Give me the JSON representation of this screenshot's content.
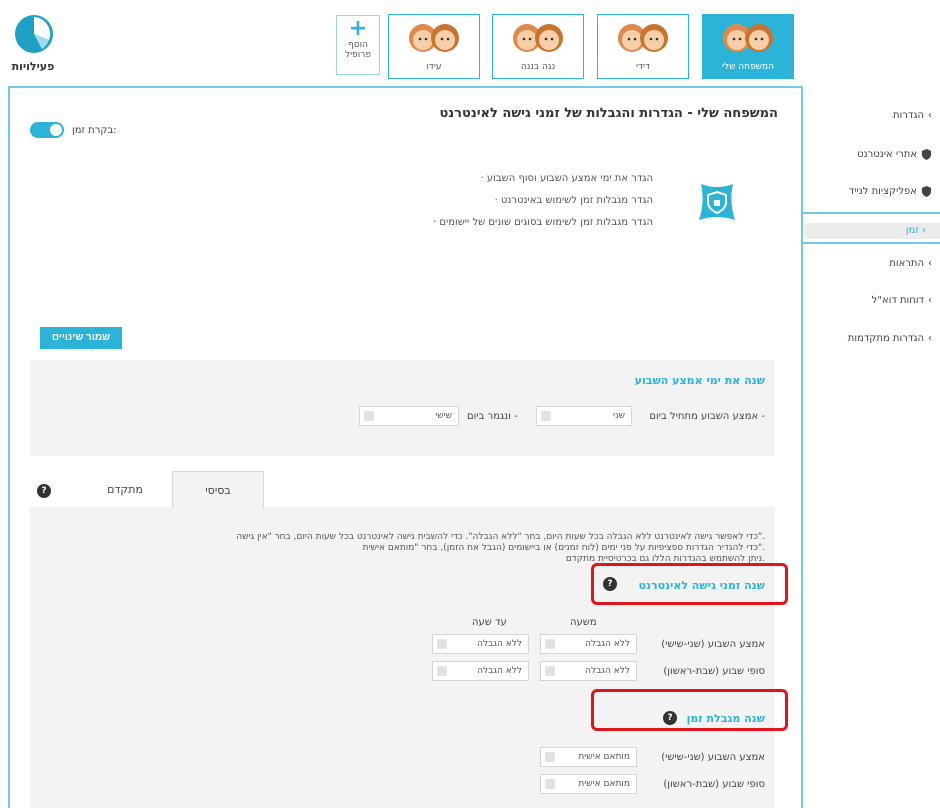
{
  "header": {
    "activity_label": "פעילויות",
    "add_profile_label_1": "הוסף",
    "add_profile_label_2": "פרופיל",
    "add_profile_symbol": "+",
    "profiles": [
      {
        "name": "המשפחה שלי",
        "active": true
      },
      {
        "name": "דידי",
        "active": false
      },
      {
        "name": "נגה בננה",
        "active": false
      },
      {
        "name": "עידו",
        "active": false
      }
    ]
  },
  "sidebar": {
    "items": [
      {
        "label": "הגדרות",
        "icon": "chevron-left-icon"
      },
      {
        "label": "אתרי אינטרנט",
        "icon": "shield-icon"
      },
      {
        "label": "אפליקציות לנייד",
        "icon": "shield-icon"
      },
      {
        "label": "זמן",
        "icon": "chevron-left-icon",
        "active": true
      },
      {
        "label": "התראות",
        "icon": "chevron-left-icon"
      },
      {
        "label": "דוחות דוא\"ל",
        "icon": "chevron-left-icon"
      },
      {
        "label": "הגדרות מתקדמות",
        "icon": "chevron-left-icon"
      }
    ]
  },
  "main": {
    "title": "המשפחה שלי - הגדרות והגבלות של זמני גישה לאינטרנט",
    "time_control_label": "בקרת זמן:",
    "time_control_on": true,
    "features": [
      "הגדר את ימי אמצע השבוע וסוף השבוע",
      "הגדר מגבלות זמן לשימוש באינטרנט",
      "הגדר מגבלות זמן לשימוש בסוגים שונים של יישומים"
    ],
    "save_label": "שמור שינויים",
    "weekdays": {
      "title": "שנה את ימי אמצע השבוע",
      "start_label": "אמצע השבוע מתחיל ביום -",
      "start_value": "שני",
      "end_label": "ונגמר ביום -",
      "end_value": "שישי"
    },
    "tabs": [
      {
        "label": "בסיסי",
        "active": true
      },
      {
        "label": "מתקדם",
        "active": false
      }
    ],
    "info_lines": [
      "כדי לאפשר גישה לאינטרנט ללא הגבלה בכל שעות היום, בחר \"ללא הגבלה\". כדי להשבית גישה לאינטרנט בכל שעות היום, בחר \"אין גישה\".",
      "כדי להגדיר הגדרות ספציפיות על פני ימים (לוח זמנים) או ביישומים (הגבל את הזמן), בחר \"מותאם אישית\".",
      "ניתן להשתמש בהגדרות הללו גם בכרטיסיית מתקדם."
    ],
    "access_times": {
      "title": "שנה זמני גישה לאינטרנט",
      "col_from": "משעה",
      "col_to": "עד שעה",
      "rows": [
        {
          "label": "אמצע השבוע (שני-שישי)",
          "from": "ללא הגבלה",
          "to": "ללא הגבלה"
        },
        {
          "label": "סופי שבוע (שבת-ראשון)",
          "from": "ללא הגבלה",
          "to": "ללא הגבלה"
        }
      ]
    },
    "time_limit": {
      "title": "שנה מגבלת זמן",
      "rows": [
        {
          "label": "אמצע השבוע (שני-שישי)",
          "value": "מותאם אישית"
        },
        {
          "label": "סופי שבוע (שבת-ראשון)",
          "value": "מותאם אישית"
        }
      ]
    },
    "help_symbol": "?"
  },
  "colors": {
    "accent": "#2bb3d8",
    "highlight_frame": "#e3131e",
    "panel_bg": "#f3f3f3"
  }
}
